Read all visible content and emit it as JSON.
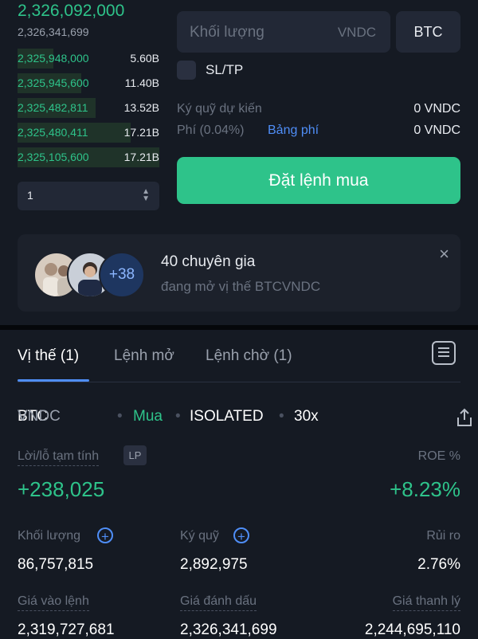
{
  "order_book": {
    "last_price": "2,326,092,000",
    "mark_price": "2,326,341,699",
    "rows": [
      {
        "price": "2,325,948,000",
        "size": "5.60B",
        "depth": 0.25
      },
      {
        "price": "2,325,945,600",
        "size": "11.40B",
        "depth": 0.45
      },
      {
        "price": "2,325,482,811",
        "size": "13.52B",
        "depth": 0.55
      },
      {
        "price": "2,325,480,411",
        "size": "17.21B",
        "depth": 0.8
      },
      {
        "price": "2,325,105,600",
        "size": "17.21B",
        "depth": 1.0
      }
    ],
    "precision_value": "1"
  },
  "order_form": {
    "volume_placeholder": "Khối lượng",
    "volume_unit": "VNDC",
    "asset_button": "BTC",
    "sltp_label": "SL/TP",
    "margin_label": "Ký quỹ dự kiến",
    "margin_value": "0 VNDC",
    "fee_label": "Phí (0.04%)",
    "fee_link": "Bảng phí",
    "fee_value": "0 VNDC",
    "buy_button": "Đặt lệnh mua"
  },
  "experts": {
    "more_count": "+38",
    "title": "40 chuyên gia",
    "subtitle": "đang mở vị thế BTCVNDC",
    "close_icon": "×"
  },
  "tabs": [
    {
      "label": "Vị thế (1)",
      "active": true
    },
    {
      "label": "Lệnh mở",
      "active": false
    },
    {
      "label": "Lệnh chờ (1)",
      "active": false
    }
  ],
  "position": {
    "base": "BTC",
    "quote": "VNDC",
    "side": "Mua",
    "margin_mode": "ISOLATED",
    "leverage": "30x",
    "pnl_label": "Lời/lỗ tạm tính",
    "lp_badge": "LP",
    "roe_label": "ROE %",
    "pnl_value": "+238,025",
    "roe_value": "+8.23%",
    "volume_label": "Khối lượng",
    "volume_value": "86,757,815",
    "margin_label": "Ký quỹ",
    "margin_value": "2,892,975",
    "risk_label": "Rủi ro",
    "risk_value": "2.76%",
    "entry_label": "Giá vào lệnh",
    "entry_value": "2,319,727,681",
    "mark_label": "Giá đánh dấu",
    "mark_value": "2,326,341,699",
    "liq_label": "Giá thanh lý",
    "liq_value": "2,244,695,110"
  },
  "colors": {
    "accent_green": "#2ec38a",
    "accent_blue": "#4f8ef7",
    "background": "#151a23"
  }
}
